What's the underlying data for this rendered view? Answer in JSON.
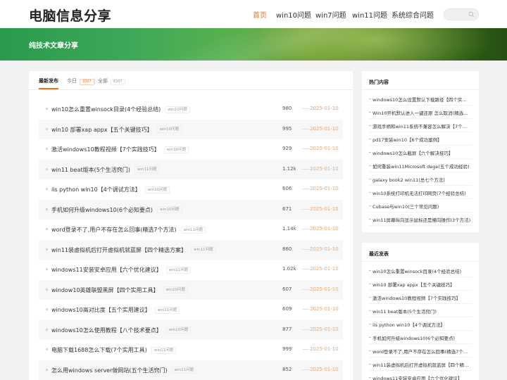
{
  "site": {
    "logo": "电脑信息分享",
    "banner_title": "纯技术文章分享"
  },
  "nav": [
    {
      "label": "首页",
      "active": true
    },
    {
      "label": "win10问题",
      "active": false
    },
    {
      "label": "win7问题",
      "active": false
    },
    {
      "label": "win11问题",
      "active": false
    },
    {
      "label": "系统综合问题",
      "active": false
    }
  ],
  "search": {
    "placeholder": "",
    "icon": "search-icon"
  },
  "tabs": [
    {
      "label": "最新发布",
      "count": ""
    },
    {
      "label": "今日",
      "count": "3307"
    },
    {
      "label": "全部",
      "count": "6307"
    }
  ],
  "posts": [
    {
      "title": "win10怎么重置winsock目录(4个经验总结)",
      "tag": "win10问题",
      "views": "980",
      "date": "2025-01-10"
    },
    {
      "title": "win10 部署xap appx【五个关键技巧】",
      "tag": "win10问题",
      "views": "995",
      "date": "2025-01-10"
    },
    {
      "title": "激活windows10教程视频【7个实践技巧】",
      "tag": "win10问题",
      "views": "929",
      "date": "2025-01-10"
    },
    {
      "title": "win11 beat版本(5个生活窍门)",
      "tag": "win11问题",
      "views": "1.12k",
      "date": "2025-01-10"
    },
    {
      "title": "iis python win10【4个调试方法】",
      "tag": "win10问题",
      "views": "606",
      "date": "2025-01-10"
    },
    {
      "title": "手机如何升级windows10(6个必知要点)",
      "tag": "win10问题",
      "views": "671",
      "date": "2025-01-10"
    },
    {
      "title": "word登录不了,用户不存在怎么回事(精选7个方法)",
      "tag": "win11问题",
      "views": "1.14k",
      "date": "2025-01-10"
    },
    {
      "title": "win11装虚拟机后打开虚拟机就蓝屏【四个精选方案】",
      "tag": "win11问题",
      "views": "860",
      "date": "2025-01-10"
    },
    {
      "title": "windows11安装安卓应用【六个优化建议】",
      "tag": "win11问题",
      "views": "1.02k",
      "date": "2025-01-10"
    },
    {
      "title": "window10英雄联盟黑屏【四个实用工具】",
      "tag": "win10问题",
      "views": "607",
      "date": "2025-01-10"
    },
    {
      "title": "windows10高对比度【五个实用建议】",
      "tag": "win11问题",
      "views": "609",
      "date": "2025-01-10"
    },
    {
      "title": "windows10怎么使用教程【八个技术要点】",
      "tag": "win10问题",
      "views": "877",
      "date": "2025-01-10"
    },
    {
      "title": "电脑下载1688怎么下载(7个实用工具)",
      "tag": "win11问题",
      "views": "999",
      "date": "2025-01-10"
    },
    {
      "title": "怎么用windows server做网站(五个生活窍门)",
      "tag": "win11问题",
      "views": "852",
      "date": "2025-01-10"
    }
  ],
  "hot": {
    "title": "热门内容",
    "items": [
      "windows10怎么设置默认下载路径【四个实用技巧】",
      "Win10开机默认进入一键还原 怎么取消(精选方法)",
      "游戏手柄和win11系统不兼容怎么解决【7个方法】",
      "pd17安装win10【6个成功案例】",
      "windows10怎么截屏【六个解决技巧】",
      "如何重装win11Microsoft dege(五个成功经验)",
      "galaxy book2 win11(总七个方法)",
      "win10系统打印机无法打印网页(7个经验总结)",
      "Cubase与win10(三个常见问题)",
      "win11屏幕纵向显示鼠标还是横向操作(3个方法)"
    ]
  },
  "recent": {
    "title": "最近发表",
    "items": [
      "win10怎么重置winsock目录(4个经验总结)",
      "win10 部署xap appx【五个关键技巧】",
      "激活windows10教程视频【7个实践技巧】",
      "win11 beat版本(5个生活窍门)",
      "iis python win10【4个调试方法】",
      "手机如何升级windows10(6个必知要点)",
      "word登录不了,用户不存在怎么回事(精选7个方法)",
      "win11装虚拟机后打开虚拟机就蓝屏【四个精选方案】",
      "windows11安装安卓应用【六个优化建议】"
    ]
  },
  "colors": {
    "accent": "#e8711a",
    "date": "#e8a76f",
    "banner_start": "#2a9a4e",
    "banner_end": "#274f12"
  }
}
